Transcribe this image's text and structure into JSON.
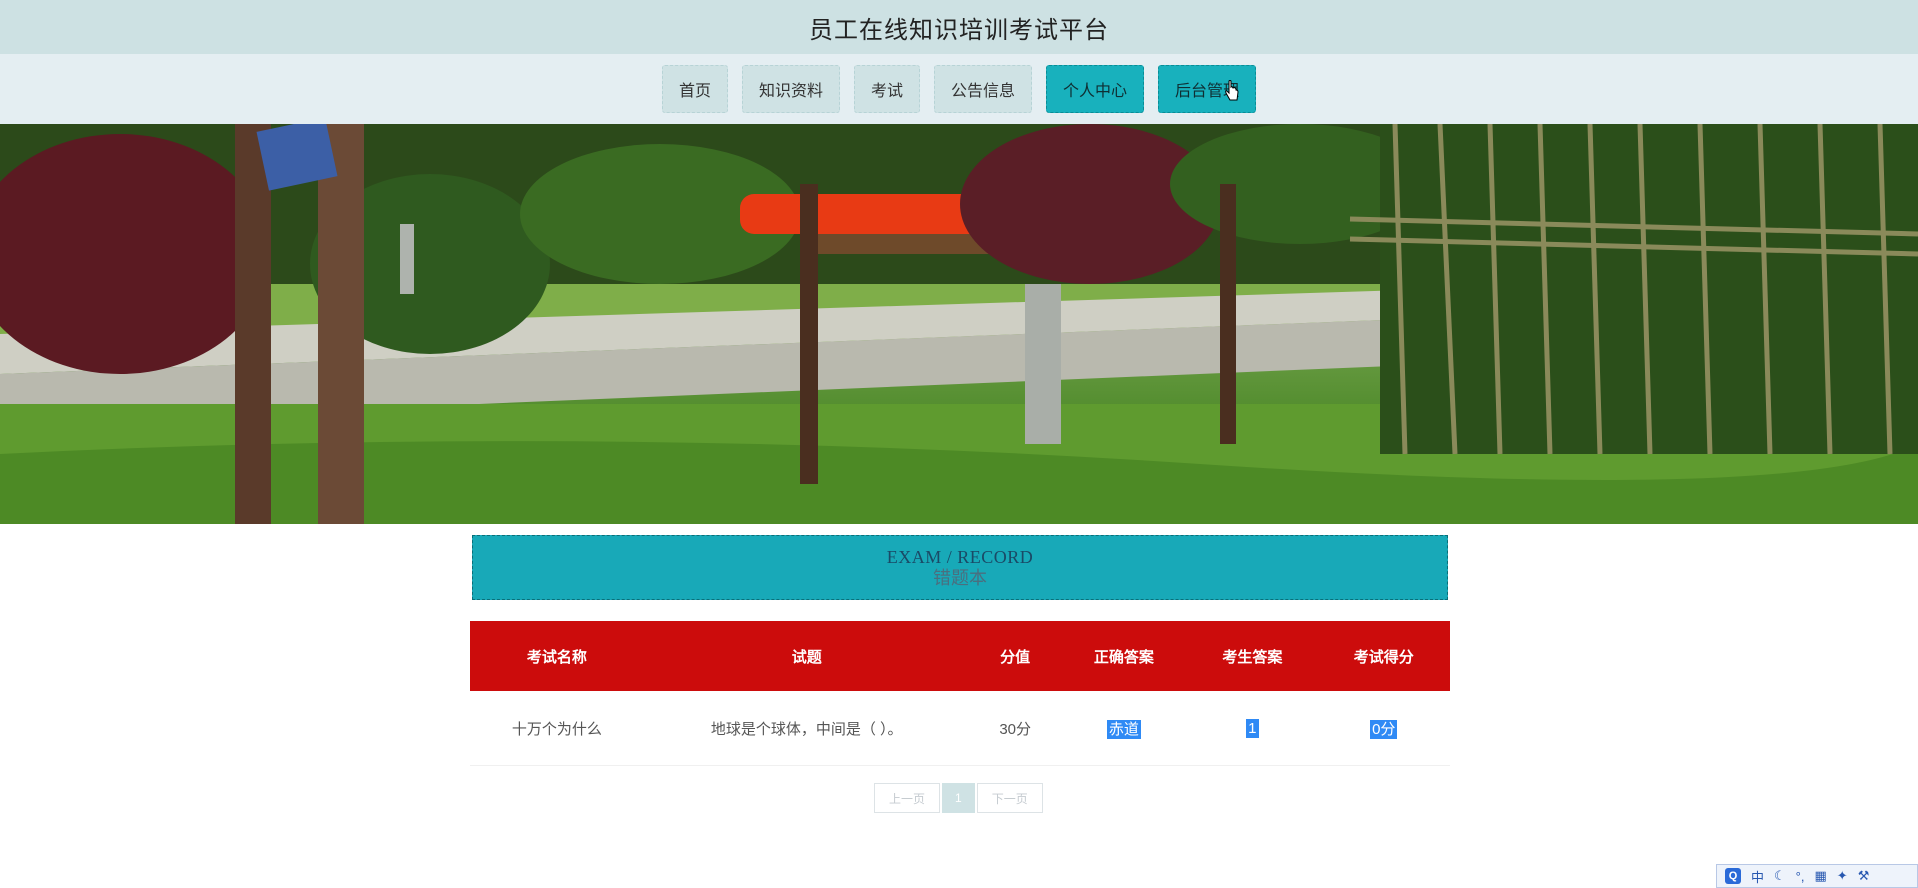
{
  "app": {
    "title": "员工在线知识培训考试平台"
  },
  "nav": {
    "items": [
      {
        "label": "首页",
        "active": false
      },
      {
        "label": "知识资料",
        "active": false
      },
      {
        "label": "考试",
        "active": false
      },
      {
        "label": "公告信息",
        "active": false
      },
      {
        "label": "个人中心",
        "active": true
      },
      {
        "label": "后台管理",
        "active": true
      }
    ]
  },
  "section": {
    "title_en": "EXAM / RECORD",
    "title_cn": "错题本"
  },
  "table": {
    "headers": [
      "考试名称",
      "试题",
      "分值",
      "正确答案",
      "考生答案",
      "考试得分"
    ],
    "rows": [
      {
        "exam_name": "十万个为什么",
        "question": "地球是个球体，中间是（ ）。",
        "score_value": "30分",
        "correct_answer": "赤道",
        "student_answer": "1",
        "exam_score": "0分"
      }
    ]
  },
  "pagination": {
    "prev": "上一页",
    "current": "1",
    "next": "下一页"
  },
  "ime": {
    "logo": "Q",
    "lang": "中"
  },
  "colors": {
    "header_bg": "#cde1e3",
    "nav_active": "#18b1bd",
    "table_head": "#cc0c0c",
    "section_head": "#18a9b8",
    "selection": "#2f8af5"
  }
}
